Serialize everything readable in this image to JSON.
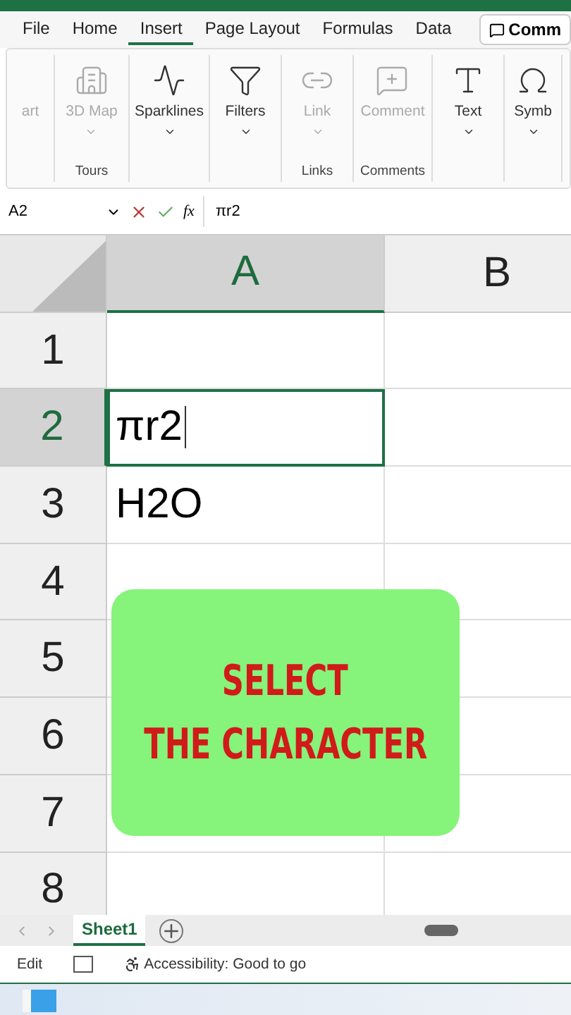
{
  "menu_tabs": [
    {
      "label": "File",
      "selected": false
    },
    {
      "label": "Home",
      "selected": false
    },
    {
      "label": "Insert",
      "selected": true
    },
    {
      "label": "Page Layout",
      "selected": false
    },
    {
      "label": "Formulas",
      "selected": false
    },
    {
      "label": "Data",
      "selected": false
    }
  ],
  "comments_button": {
    "label": "Comm"
  },
  "ribbon_groups": [
    {
      "items": [
        {
          "kind": "none",
          "label": "art",
          "disabled": true,
          "dropdown": false
        }
      ]
    },
    {
      "label": "Tours",
      "items": [
        {
          "kind": "map",
          "label": "3D Map",
          "disabled": true,
          "dropdown": true
        }
      ]
    },
    {
      "items": [
        {
          "kind": "sparkline",
          "label": "Sparklines",
          "disabled": false,
          "dropdown": true
        }
      ]
    },
    {
      "items": [
        {
          "kind": "filter",
          "label": "Filters",
          "disabled": false,
          "dropdown": true
        }
      ]
    },
    {
      "label": "Links",
      "items": [
        {
          "kind": "link",
          "label": "Link",
          "disabled": true,
          "dropdown": true
        }
      ]
    },
    {
      "label": "Comments",
      "items": [
        {
          "kind": "comment",
          "label": "Comment",
          "disabled": true,
          "dropdown": false
        }
      ]
    },
    {
      "items": [
        {
          "kind": "text",
          "label": "Text",
          "disabled": false,
          "dropdown": true
        }
      ]
    },
    {
      "items": [
        {
          "kind": "symbol",
          "label": "Symb",
          "disabled": false,
          "dropdown": true
        }
      ]
    }
  ],
  "formula_bar": {
    "name_box": "A2",
    "function_label": "fx",
    "formula": "πr2"
  },
  "columns": [
    {
      "label": "A",
      "selected": true
    },
    {
      "label": "B",
      "selected": false
    }
  ],
  "rows": [
    {
      "number": "1",
      "selected": false,
      "cells": [
        "",
        ""
      ]
    },
    {
      "number": "2",
      "selected": true,
      "cells": [
        "πr2",
        ""
      ]
    },
    {
      "number": "3",
      "selected": false,
      "cells": [
        "H2O",
        ""
      ]
    },
    {
      "number": "4",
      "selected": false,
      "cells": [
        "",
        ""
      ]
    },
    {
      "number": "5",
      "selected": false,
      "cells": [
        "",
        ""
      ]
    },
    {
      "number": "6",
      "selected": false,
      "cells": [
        "",
        ""
      ]
    },
    {
      "number": "7",
      "selected": false,
      "cells": [
        "",
        ""
      ]
    },
    {
      "number": "8",
      "selected": false,
      "cells": [
        "",
        ""
      ]
    }
  ],
  "sheet_tabs": [
    {
      "label": "Sheet1",
      "selected": true
    }
  ],
  "status_bar": {
    "mode": "Edit",
    "accessibility": "Accessibility: Good to go"
  },
  "caption": [
    "SELECT",
    "THE CHARACTER"
  ]
}
